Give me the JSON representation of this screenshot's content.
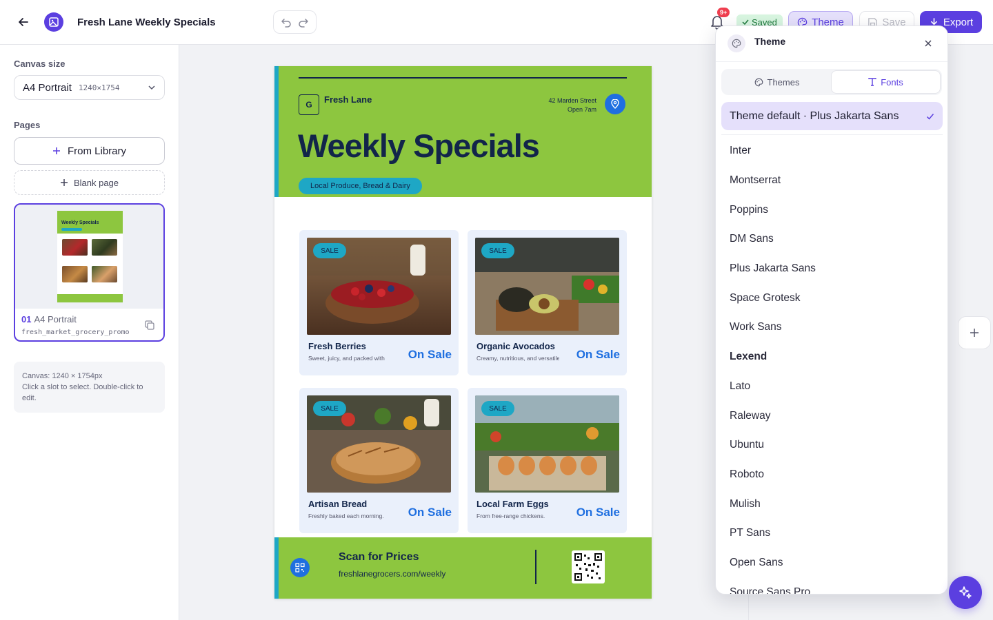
{
  "header": {
    "doc_title": "Fresh Lane Weekly Specials",
    "notification_count": "9+",
    "saved_label": "Saved",
    "theme_label": "Theme",
    "save_label": "Save",
    "export_label": "Export"
  },
  "sidebar": {
    "canvas_size_label": "Canvas size",
    "canvas_size_value": "A4 Portrait",
    "canvas_size_dims": "1240×1754",
    "pages_label": "Pages",
    "from_library_label": "From Library",
    "blank_page_label": "Blank page",
    "page": {
      "number": "01",
      "name": "A4 Portrait",
      "file": "fresh_market_grocery_promo"
    },
    "info_line1": "Canvas: 1240 × 1754px",
    "info_line2": "Click a slot to select. Double-click to edit."
  },
  "poster": {
    "brand_initial": "G",
    "brand_name": "Fresh Lane",
    "address": "42 Marden Street",
    "hours": "Open 7am",
    "title": "Weekly Specials",
    "tagline": "Local Produce, Bread & Dairy",
    "products": [
      {
        "name": "Fresh Berries",
        "desc": "Sweet, juicy, and packed with",
        "badge": "SALE",
        "price": "On Sale"
      },
      {
        "name": "Organic Avocados",
        "desc": "Creamy, nutritious, and versatile.",
        "badge": "SALE",
        "price": "On Sale"
      },
      {
        "name": "Artisan Bread",
        "desc": "Freshly baked each morning.",
        "badge": "SALE",
        "price": "On Sale"
      },
      {
        "name": "Local Farm Eggs",
        "desc": "From free-range chickens.",
        "badge": "SALE",
        "price": "On Sale"
      }
    ],
    "footer_title": "Scan for Prices",
    "footer_url": "freshlanegrocers.com/weekly",
    "colors": {
      "primary": "#8dc63f",
      "accent": "#1ea7c5",
      "navy": "#12254a",
      "blue": "#1f6fe0"
    }
  },
  "theme_panel": {
    "title": "Theme",
    "tabs": [
      "Themes",
      "Fonts"
    ],
    "active_tab": "Fonts",
    "default_font": "Theme default · Plus Jakarta Sans",
    "fonts": [
      "Inter",
      "Montserrat",
      "Poppins",
      "DM Sans",
      "Plus Jakarta Sans",
      "Space Grotesk",
      "Work Sans",
      "Lexend",
      "Lato",
      "Raleway",
      "Ubuntu",
      "Roboto",
      "Mulish",
      "PT Sans",
      "Open Sans",
      "Source Sans Pro"
    ]
  },
  "colors": {
    "accent": "#5b3fe0",
    "accent_light": "#e5e0fb",
    "saved_bg": "#d8f5e0"
  }
}
